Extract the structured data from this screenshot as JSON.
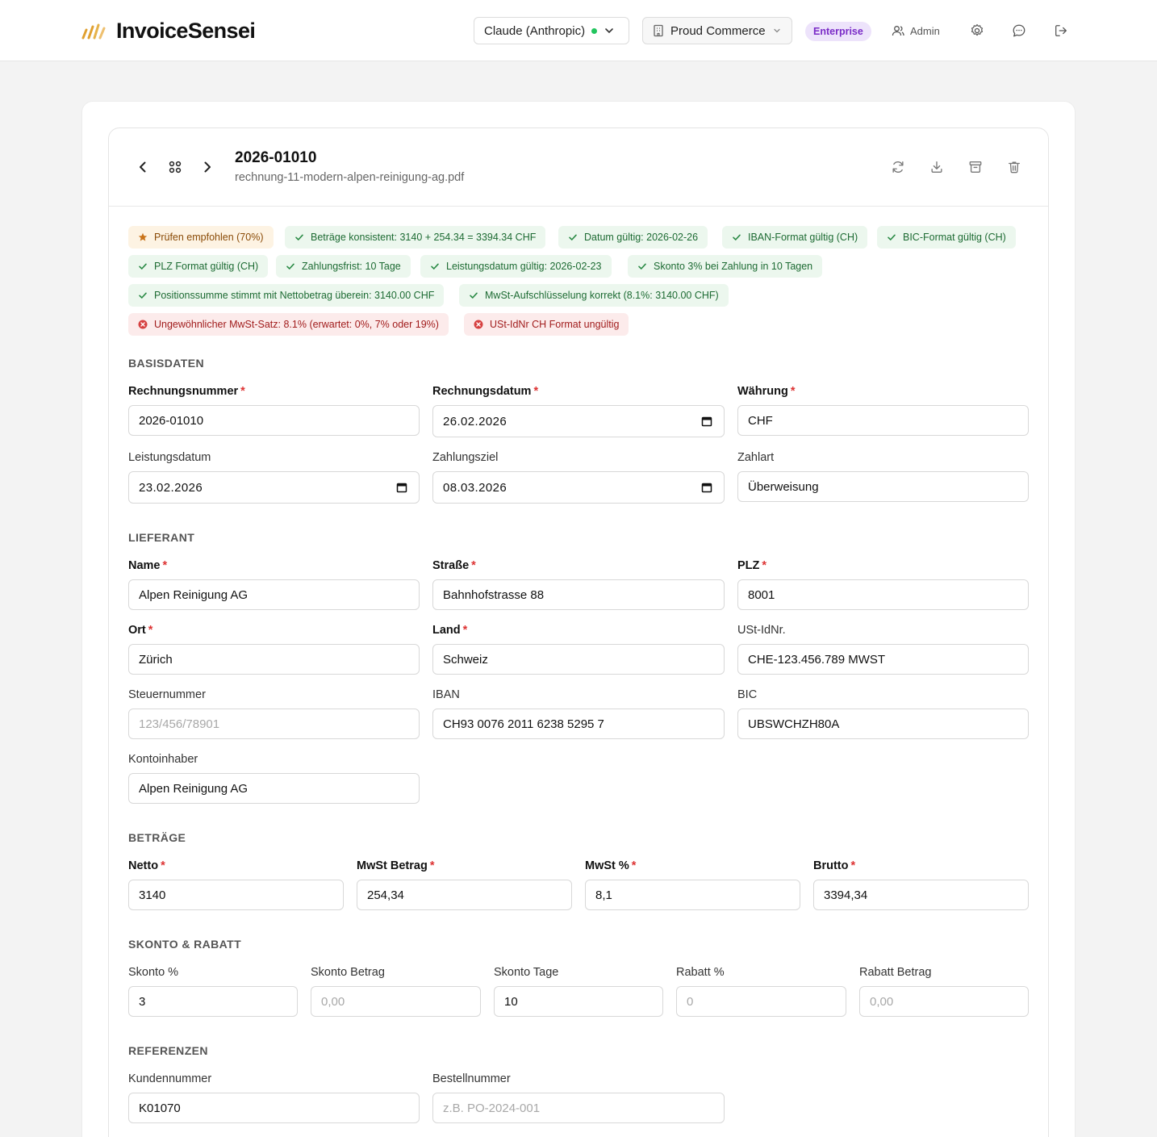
{
  "header": {
    "brand": "InvoiceSensei",
    "model_select": "Claude (Anthropic)",
    "company_select": "Proud Commerce",
    "plan_badge": "Enterprise",
    "admin_label": "Admin"
  },
  "document": {
    "title": "2026-01010",
    "filename": "rechnung-11-modern-alpen-reinigung-ag.pdf"
  },
  "badges": [
    {
      "type": "warn",
      "text": "Prüfen empfohlen (70%)"
    },
    {
      "type": "ok",
      "text": "Beträge konsistent: 3140 + 254.34 = 3394.34 CHF"
    },
    {
      "type": "ok",
      "text": "Datum gültig: 2026-02-26"
    },
    {
      "type": "ok",
      "text": "IBAN-Format gültig (CH)"
    },
    {
      "type": "ok",
      "text": "BIC-Format gültig (CH)"
    },
    {
      "type": "ok",
      "text": "PLZ Format gültig (CH)"
    },
    {
      "type": "ok",
      "text": "Zahlungsfrist: 10 Tage"
    },
    {
      "type": "ok",
      "text": "Leistungsdatum gültig: 2026-02-23"
    },
    {
      "type": "ok",
      "text": "Skonto 3% bei Zahlung in 10 Tagen"
    },
    {
      "type": "ok",
      "text": "Positionssumme stimmt mit Nettobetrag überein: 3140.00 CHF"
    },
    {
      "type": "ok",
      "text": "MwSt-Aufschlüsselung korrekt (8.1%: 3140.00 CHF)"
    },
    {
      "type": "err",
      "text": "Ungewöhnlicher MwSt-Satz: 8.1% (erwartet: 0%, 7% oder 19%)"
    },
    {
      "type": "err",
      "text": "USt-IdNr CH Format ungültig"
    }
  ],
  "sections": {
    "basis": "BASISDATEN",
    "lieferant": "LIEFERANT",
    "betraege": "BETRÄGE",
    "skonto": "SKONTO & RABATT",
    "referenzen": "REFERENZEN"
  },
  "fields": {
    "rechnungsnummer": {
      "label": "Rechnungsnummer",
      "value": "2026-01010"
    },
    "rechnungsdatum": {
      "label": "Rechnungsdatum",
      "value": "26.02.2026"
    },
    "waehrung": {
      "label": "Währung",
      "value": "CHF"
    },
    "leistungsdatum": {
      "label": "Leistungsdatum",
      "value": "23.02.2026"
    },
    "zahlungsziel": {
      "label": "Zahlungsziel",
      "value": "08.03.2026"
    },
    "zahlart": {
      "label": "Zahlart",
      "value": "Überweisung"
    },
    "name": {
      "label": "Name",
      "value": "Alpen Reinigung AG"
    },
    "strasse": {
      "label": "Straße",
      "value": "Bahnhofstrasse 88"
    },
    "plz": {
      "label": "PLZ",
      "value": "8001"
    },
    "ort": {
      "label": "Ort",
      "value": "Zürich"
    },
    "land": {
      "label": "Land",
      "value": "Schweiz"
    },
    "ustid": {
      "label": "USt-IdNr.",
      "value": "CHE-123.456.789 MWST"
    },
    "steuernummer": {
      "label": "Steuernummer",
      "placeholder": "123/456/78901"
    },
    "iban": {
      "label": "IBAN",
      "value": "CH93 0076 2011 6238 5295 7"
    },
    "bic": {
      "label": "BIC",
      "value": "UBSWCHZH80A"
    },
    "kontoinhaber": {
      "label": "Kontoinhaber",
      "value": "Alpen Reinigung AG"
    },
    "netto": {
      "label": "Netto",
      "value": "3140"
    },
    "mwst_betrag": {
      "label": "MwSt Betrag",
      "value": "254,34"
    },
    "mwst_prozent": {
      "label": "MwSt %",
      "value": "8,1"
    },
    "brutto": {
      "label": "Brutto",
      "value": "3394,34"
    },
    "skonto_prozent": {
      "label": "Skonto %",
      "value": "3"
    },
    "skonto_betrag": {
      "label": "Skonto Betrag",
      "placeholder": "0,00"
    },
    "skonto_tage": {
      "label": "Skonto Tage",
      "value": "10"
    },
    "rabatt_prozent": {
      "label": "Rabatt %",
      "placeholder": "0"
    },
    "rabatt_betrag": {
      "label": "Rabatt Betrag",
      "placeholder": "0,00"
    },
    "kundennummer": {
      "label": "Kundennummer",
      "value": "K01070"
    },
    "bestellnummer": {
      "label": "Bestellnummer",
      "placeholder": "z.B. PO-2024-001"
    }
  },
  "required_marker": "*",
  "colors": {
    "accent_purple": "#7a2bc7",
    "ok_green": "#1d6b33",
    "error_red": "#a11c1c",
    "required_red": "#dd3333"
  }
}
